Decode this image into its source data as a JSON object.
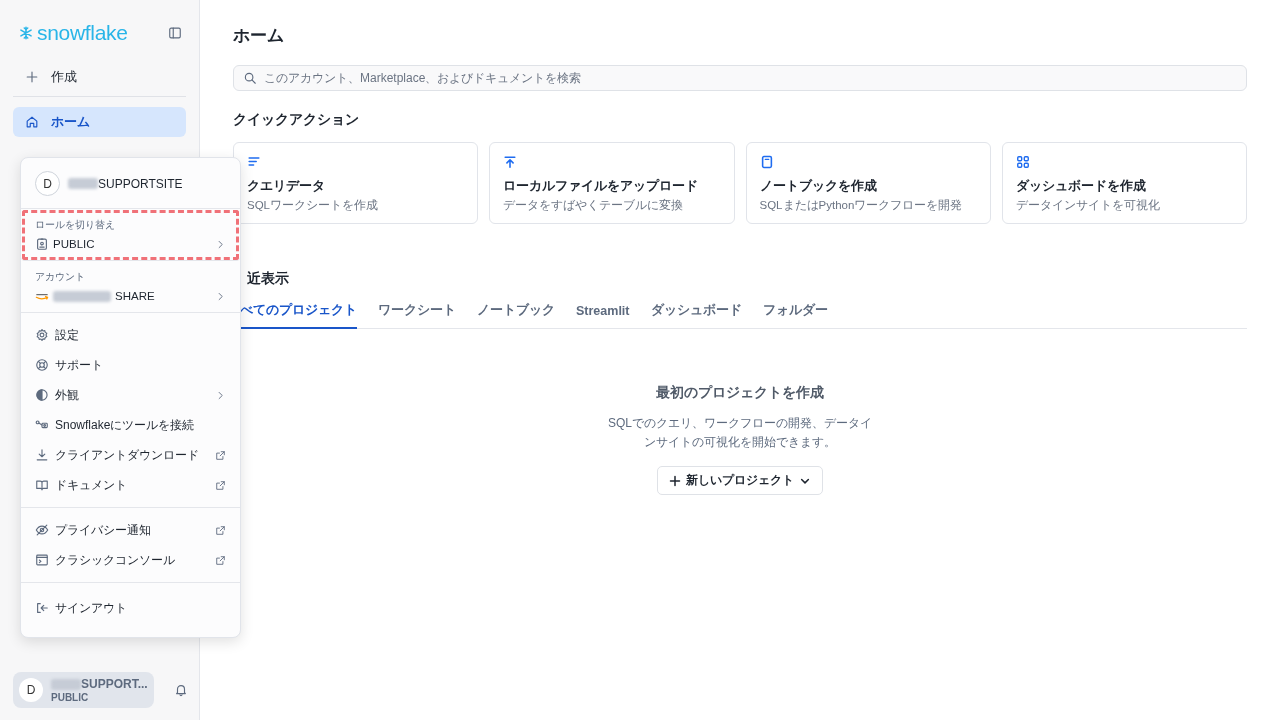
{
  "sidebar": {
    "logo": "snowflake",
    "create": "作成",
    "items": [
      {
        "label": "ホーム",
        "selected": true
      }
    ],
    "user": {
      "avatar": "D",
      "name": "SUPPORT...",
      "role": "PUBLIC"
    }
  },
  "main": {
    "title": "ホーム",
    "search": {
      "placeholder": "このアカウント、Marketplace、およびドキュメントを検索"
    },
    "quick_actions": {
      "title": "クイックアクション",
      "cards": [
        {
          "title": "クエリデータ",
          "subtitle": "SQLワークシートを作成"
        },
        {
          "title": "ローカルファイルをアップロード",
          "subtitle": "データをすばやくテーブルに変換"
        },
        {
          "title": "ノートブックを作成",
          "subtitle": "SQLまたはPythonワークフローを開発"
        },
        {
          "title": "ダッシュボードを作成",
          "subtitle": "データインサイトを可視化"
        }
      ]
    },
    "recent": {
      "title": "近表示",
      "tabs": [
        {
          "label": "べてのプロジェクト",
          "selected": true
        },
        {
          "label": "ワークシート",
          "selected": false
        },
        {
          "label": "ノートブック",
          "selected": false
        },
        {
          "label": "Streamlit",
          "selected": false
        },
        {
          "label": "ダッシュボード",
          "selected": false
        },
        {
          "label": "フォルダー",
          "selected": false
        }
      ],
      "empty": {
        "title": "最初のプロジェクトを作成",
        "text": "SQLでのクエリ、ワークフローの開発、データインサイトの可視化を開始できます。",
        "button": "新しいプロジェクト"
      }
    }
  },
  "user_menu": {
    "avatar": "D",
    "user": "SUPPORTSITE",
    "role": {
      "label": "ロールを切り替え",
      "value": "PUBLIC",
      "highlighted": true
    },
    "account": {
      "label": "アカウント",
      "value": "SHARE"
    },
    "groups": [
      [
        {
          "label": "設定",
          "kind": "plain"
        },
        {
          "label": "サポート",
          "kind": "plain"
        },
        {
          "label": "外観",
          "kind": "submenu"
        },
        {
          "label": "Snowflakeにツールを接続",
          "kind": "plain"
        },
        {
          "label": "クライアントダウンロード",
          "kind": "external"
        },
        {
          "label": "ドキュメント",
          "kind": "external"
        }
      ],
      [
        {
          "label": "プライバシー通知",
          "kind": "external"
        },
        {
          "label": "クラシックコンソール",
          "kind": "external"
        }
      ],
      [
        {
          "label": "サインアウト",
          "kind": "plain"
        }
      ]
    ]
  }
}
